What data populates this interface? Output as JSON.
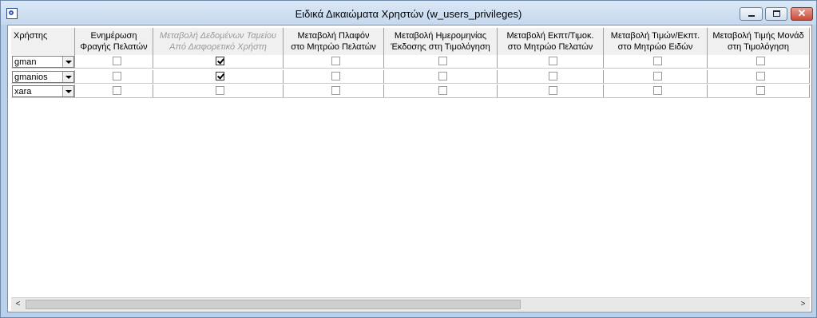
{
  "window": {
    "title": "Ειδικά Δικαιώματα Χρηστών    (w_users_privileges)",
    "close_glyph": "✕"
  },
  "grid": {
    "columns": [
      {
        "label_line1": "Χρήστης",
        "label_line2": "",
        "dim": false
      },
      {
        "label_line1": "Ενημέρωση",
        "label_line2": "Φραγής Πελατών",
        "dim": false
      },
      {
        "label_line1": "Μεταβολή Δεδομένων Ταμείου",
        "label_line2": "Από Διαφορετικό Χρήστη",
        "dim": true
      },
      {
        "label_line1": "Μεταβολή Πλαφόν",
        "label_line2": "στο Μητρώο Πελατών",
        "dim": false
      },
      {
        "label_line1": "Μεταβολή Ημερομηνίας",
        "label_line2": "Έκδοσης στη Τιμολόγηση",
        "dim": false
      },
      {
        "label_line1": "Μεταβολή Εκπτ/Τιμοκ.",
        "label_line2": "στο Μητρώο Πελατών",
        "dim": false
      },
      {
        "label_line1": "Μεταβολή Τιμών/Εκπτ.",
        "label_line2": "στο Μητρώο Ειδών",
        "dim": false
      },
      {
        "label_line1": "Μεταβολή Τιμής Μονάδ",
        "label_line2": "στη Τιμολόγηση",
        "dim": false
      }
    ],
    "rows": [
      {
        "user": "gman",
        "checks": [
          false,
          true,
          false,
          false,
          false,
          false,
          false
        ]
      },
      {
        "user": "gmanios",
        "checks": [
          false,
          true,
          false,
          false,
          false,
          false,
          false
        ]
      },
      {
        "user": "xara",
        "checks": [
          false,
          false,
          false,
          false,
          false,
          false,
          false
        ]
      }
    ]
  },
  "scrollbar": {
    "left_arrow": "<",
    "right_arrow": ">"
  }
}
